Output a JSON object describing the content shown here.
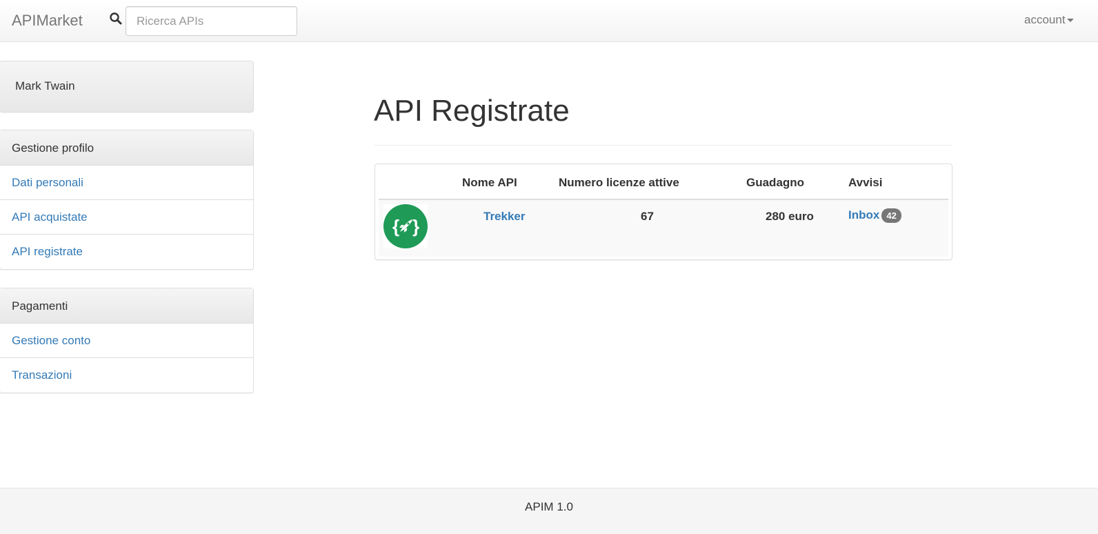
{
  "navbar": {
    "brand": "APIMarket",
    "search_placeholder": "Ricerca APIs",
    "search_value": "",
    "account_label": "account"
  },
  "sidebar": {
    "user_name": "Mark Twain",
    "profile": {
      "heading": "Gestione profilo",
      "items": [
        "Dati personali",
        "API acquistate",
        "API registrate"
      ]
    },
    "payments": {
      "heading": "Pagamenti",
      "items": [
        "Gestione conto",
        "Transazioni"
      ]
    }
  },
  "main": {
    "title": "API Registrate",
    "table": {
      "headers": [
        "Nome API",
        "Numero licenze attive",
        "Guadagno",
        "Avvisi"
      ],
      "rows": [
        {
          "logo_icon": "rocket-braces-icon",
          "name": "Trekker",
          "licenses": "67",
          "earnings": "280 euro",
          "alerts_link": "Inbox",
          "alerts_count": "42"
        }
      ]
    }
  },
  "footer": {
    "text": "APIM 1.0"
  },
  "colors": {
    "link": "#337ab7",
    "badge": "#777777",
    "logo_green": "#1f9a57"
  }
}
